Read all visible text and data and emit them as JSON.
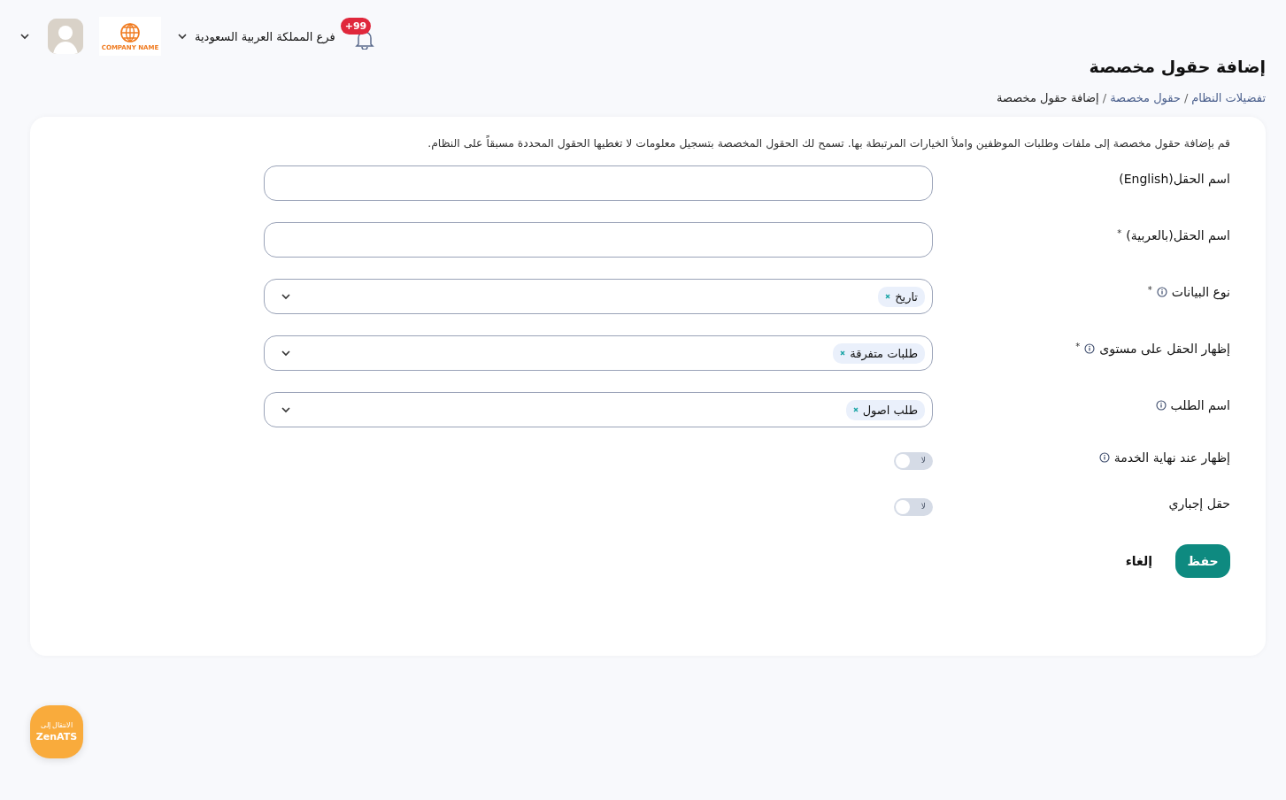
{
  "header": {
    "notification_count": "+99",
    "branch": "فرع المملكة العربية السعودية",
    "logo_text": "COMPANY NAME"
  },
  "page": {
    "title": "إضافة حقول مخصصة",
    "separator": "/",
    "breadcrumb": [
      {
        "label": "تفضيلات النظام",
        "link": true
      },
      {
        "label": "حقول مخصصة",
        "link": true
      },
      {
        "label": "إضافة حقول مخصصة",
        "link": false
      }
    ]
  },
  "form": {
    "description": "قم بإضافة حقول مخصصة إلى ملفات وطلبات الموظفين واملأ الخيارات المرتبطة بها. تسمح لك الحقول المخصصة بتسجيل معلومات لا تغطيها الحقول المحددة مسبقاً على النظام.",
    "fields": [
      {
        "kind": "text",
        "label": "اسم الحقل(English)",
        "info": false
      },
      {
        "kind": "text",
        "label": "اسم الحقل(بالعربية)",
        "asterisk": "*",
        "info": false
      },
      {
        "kind": "select",
        "label": "نوع البيانات",
        "asterisk": "*",
        "info": true,
        "tags": [
          "تاريخ"
        ]
      },
      {
        "kind": "select",
        "label": "إظهار الحقل على مستوى",
        "asterisk": "*",
        "info": true,
        "tags": [
          "طلبات متفرقة"
        ]
      },
      {
        "kind": "select",
        "label": "اسم الطلب",
        "info": true,
        "tags": [
          "طلب اصول"
        ]
      },
      {
        "kind": "toggle",
        "label": "إظهار عند نهاية الخدمة",
        "info": true,
        "on": false,
        "state_text": "لا"
      },
      {
        "kind": "toggle",
        "label": "حقل إجباري",
        "info": false,
        "on": false,
        "state_text": "لا"
      }
    ],
    "buttons": {
      "save": "حفظ",
      "cancel": "إلغاء"
    }
  },
  "switch_button": {
    "line1": "الانتقال إلى",
    "line2": "ZenATS"
  }
}
